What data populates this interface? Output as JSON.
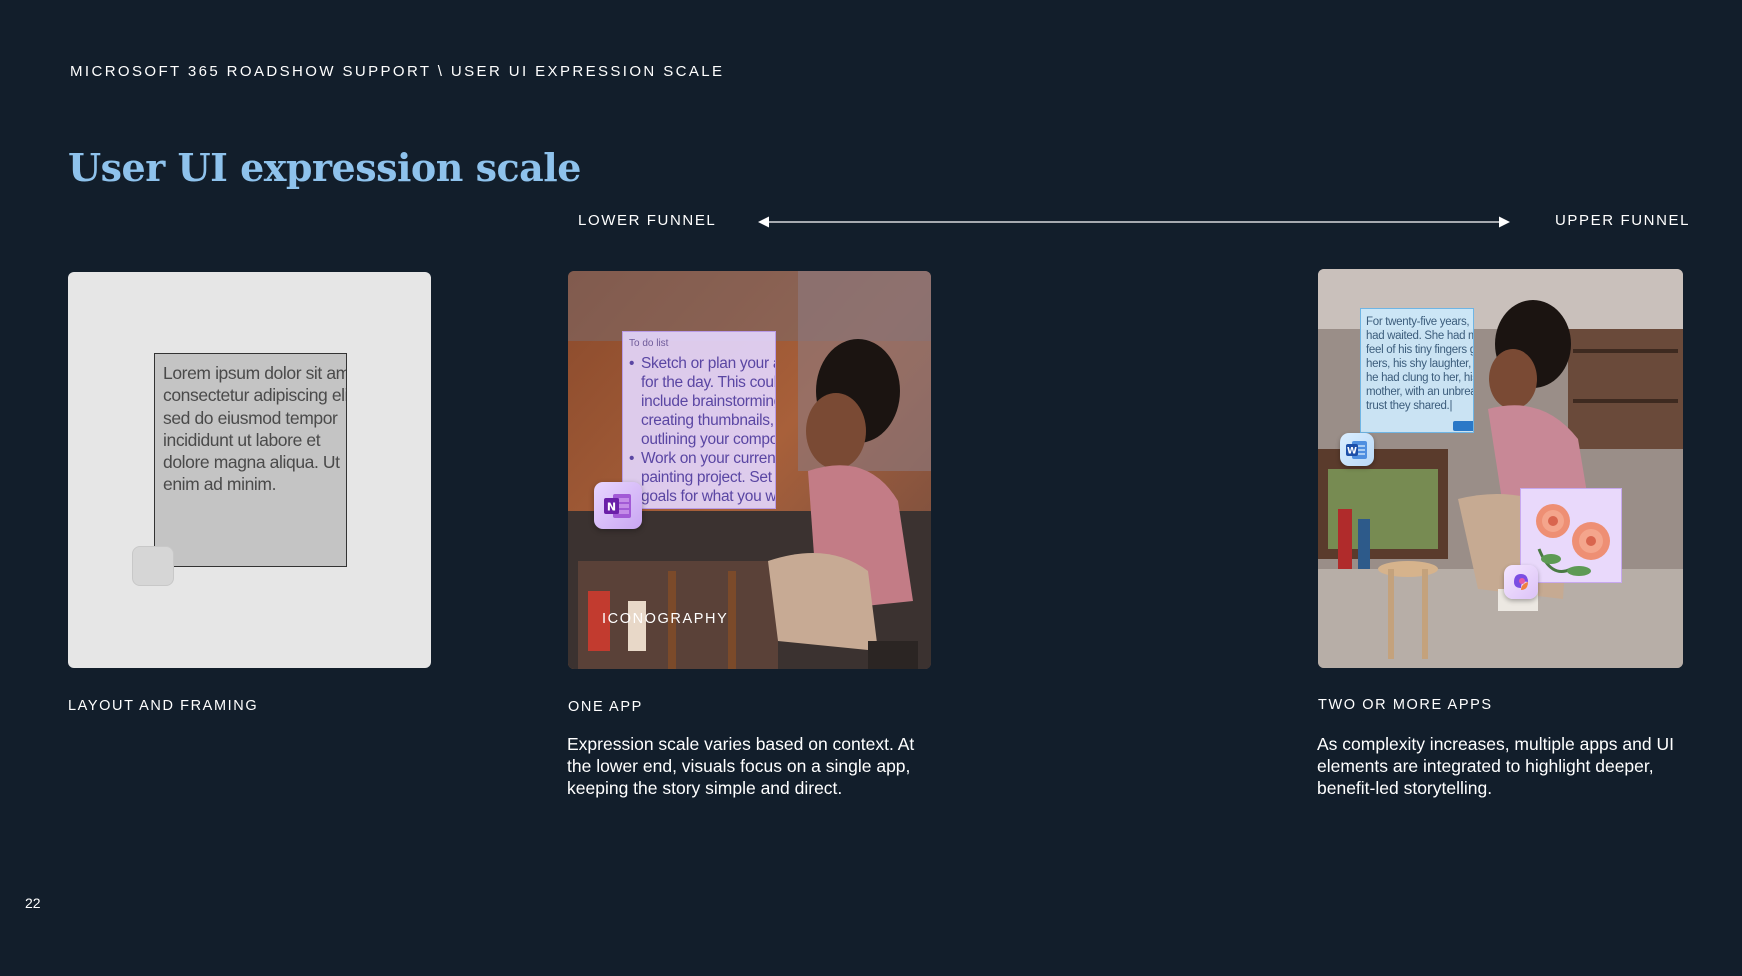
{
  "header": {
    "breadcrumb": "MICROSOFT 365 ROADSHOW SUPPORT \\ USER UI EXPRESSION SCALE",
    "title": "User UI expression scale"
  },
  "funnel": {
    "left_label": "LOWER FUNNEL",
    "right_label": "UPPER FUNNEL"
  },
  "cards": [
    {
      "label": "LAYOUT AND FRAMING",
      "placeholder_text": "Lorem ipsum dolor sit amet,\nconsectetur adipiscing elit,\nsed do eiusmod tempor\nincididunt ut labore et\ndolore magna aliqua. Ut\nenim ad minim."
    },
    {
      "label": "ONE APP",
      "description": "Expression scale varies based on context. At the lower end, visuals focus on a single app, keeping the story simple and direct.",
      "overlay_caption": "ICONOGRAPHY",
      "todo_title": "To do list",
      "todo_items": [
        "Sketch or plan your artwork\nfor the day. This could\ninclude brainstorming,\ncreating thumbnails, or\noutlining your composition.",
        "Work on your current\npainting project. Set some\ngoals for what you want to\nachieve, such as"
      ],
      "app_icon": "onenote-icon",
      "app_letter": "N"
    },
    {
      "label": "TWO OR MORE APPS",
      "description": "As complexity increases, multiple apps and UI elements are integrated to highlight deeper, benefit-led storytelling.",
      "doc_text": "For twenty-five years, Eli\nhad waited. She had met\nfeel of his tiny fingers gr\nhers, his shy laughter, th\nhe had clung to her, his\nmother, with an unbreak\ntrust they shared.|",
      "app_icons": [
        "word-icon",
        "copilot-icon"
      ],
      "word_letter": "W"
    }
  ],
  "page_number": "22",
  "colors": {
    "background": "#121e2b",
    "title": "#8ec2ec",
    "text": "#ffffff"
  }
}
